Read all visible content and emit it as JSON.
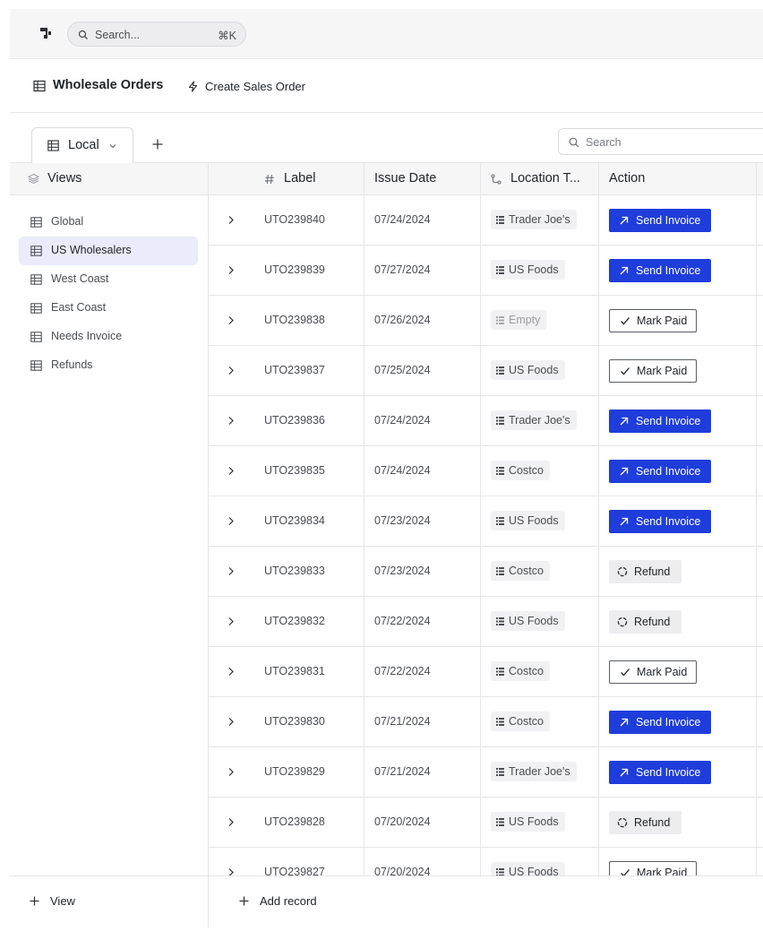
{
  "header": {
    "global_search_placeholder": "Search...",
    "global_search_shortcut": "⌘K"
  },
  "titlebar": {
    "title": "Wholesale Orders",
    "create_label": "Create Sales Order"
  },
  "tabs": {
    "active_tab": "Local",
    "search_placeholder": "Search"
  },
  "sidebar": {
    "header": "Views",
    "items": [
      {
        "label": "Global",
        "active": false
      },
      {
        "label": "US Wholesalers",
        "active": true
      },
      {
        "label": "West Coast",
        "active": false
      },
      {
        "label": "East Coast",
        "active": false
      },
      {
        "label": "Needs Invoice",
        "active": false
      },
      {
        "label": "Refunds",
        "active": false
      }
    ],
    "add_view_label": "View"
  },
  "table": {
    "columns": {
      "label": "Label",
      "issue_date": "Issue Date",
      "location": "Location T...",
      "action": "Action"
    },
    "rows": [
      {
        "label": "UTO239840",
        "date": "07/24/2024",
        "location": "Trader Joe's",
        "action": "send",
        "action_label": "Send Invoice"
      },
      {
        "label": "UTO239839",
        "date": "07/27/2024",
        "location": "US Foods",
        "action": "send",
        "action_label": "Send Invoice"
      },
      {
        "label": "UTO239838",
        "date": "07/26/2024",
        "location": "Empty",
        "location_empty": true,
        "action": "paid",
        "action_label": "Mark Paid"
      },
      {
        "label": "UTO239837",
        "date": "07/25/2024",
        "location": "US Foods",
        "action": "paid",
        "action_label": "Mark Paid"
      },
      {
        "label": "UTO239836",
        "date": "07/24/2024",
        "location": "Trader Joe's",
        "action": "send",
        "action_label": "Send Invoice"
      },
      {
        "label": "UTO239835",
        "date": "07/24/2024",
        "location": "Costco",
        "action": "send",
        "action_label": "Send Invoice"
      },
      {
        "label": "UTO239834",
        "date": "07/23/2024",
        "location": "US Foods",
        "action": "send",
        "action_label": "Send Invoice"
      },
      {
        "label": "UTO239833",
        "date": "07/23/2024",
        "location": "Costco",
        "action": "refund",
        "action_label": "Refund"
      },
      {
        "label": "UTO239832",
        "date": "07/22/2024",
        "location": "US Foods",
        "action": "refund",
        "action_label": "Refund"
      },
      {
        "label": "UTO239831",
        "date": "07/22/2024",
        "location": "Costco",
        "action": "paid",
        "action_label": "Mark Paid"
      },
      {
        "label": "UTO239830",
        "date": "07/21/2024",
        "location": "Costco",
        "action": "send",
        "action_label": "Send Invoice"
      },
      {
        "label": "UTO239829",
        "date": "07/21/2024",
        "location": "Trader Joe's",
        "action": "send",
        "action_label": "Send Invoice"
      },
      {
        "label": "UTO239828",
        "date": "07/20/2024",
        "location": "US Foods",
        "action": "refund",
        "action_label": "Refund"
      },
      {
        "label": "UTO239827",
        "date": "07/20/2024",
        "location": "US Foods",
        "action": "paid",
        "action_label": "Mark Paid"
      }
    ],
    "add_record_label": "Add record"
  },
  "colors": {
    "accent": "#1f3ddb",
    "active_view_bg": "#eaecfb",
    "border": "#e6e6e8",
    "header_bg": "#f6f6f7"
  }
}
